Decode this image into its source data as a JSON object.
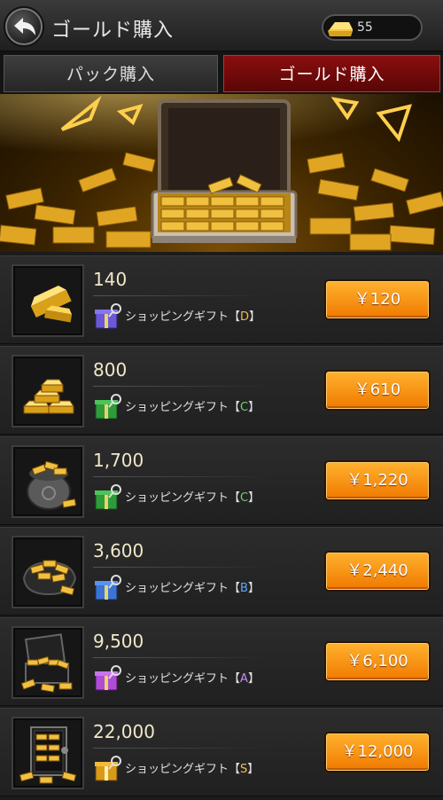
{
  "header": {
    "title": "ゴールド購入",
    "gold_balance": "55",
    "back_icon": "back-arrow-icon",
    "gold_icon": "gold-ingot-icon"
  },
  "tabs": [
    {
      "label": "パック購入",
      "active": false
    },
    {
      "label": "ゴールド購入",
      "active": true
    }
  ],
  "colors": {
    "accent": "#f59a10",
    "active_tab": "#7a0b0b",
    "rank_D": "#f5b942",
    "rank_C": "#6fd06f",
    "rank_B": "#5aa6ff",
    "rank_A": "#c88cff",
    "rank_S": "#f5c842"
  },
  "products": [
    {
      "amount": "140",
      "gift_label": "ショッピングギフト",
      "gift_rank": "D",
      "gift_open": "【",
      "gift_close": "】",
      "price": "￥120",
      "gift_color": "#7a5cff",
      "icon": "gold-bar-icon"
    },
    {
      "amount": "800",
      "gift_label": "ショッピングギフト",
      "gift_rank": "C",
      "gift_open": "【",
      "gift_close": "】",
      "price": "￥610",
      "gift_color": "#2f9c3a",
      "icon": "gold-stack-icon"
    },
    {
      "amount": "1,700",
      "gift_label": "ショッピングギフト",
      "gift_rank": "C",
      "gift_open": "【",
      "gift_close": "】",
      "price": "￥1,220",
      "gift_color": "#2f9c3a",
      "icon": "gold-sack-icon"
    },
    {
      "amount": "3,600",
      "gift_label": "ショッピングギフト",
      "gift_rank": "B",
      "gift_open": "【",
      "gift_close": "】",
      "price": "￥2,440",
      "gift_color": "#3c74d6",
      "icon": "gold-bag-icon"
    },
    {
      "amount": "9,500",
      "gift_label": "ショッピングギフト",
      "gift_rank": "A",
      "gift_open": "【",
      "gift_close": "】",
      "price": "￥6,100",
      "gift_color": "#b04dd6",
      "icon": "gold-chest-icon"
    },
    {
      "amount": "22,000",
      "gift_label": "ショッピングギフト",
      "gift_rank": "S",
      "gift_open": "【",
      "gift_close": "】",
      "price": "￥12,000",
      "gift_color": "#d99a1a",
      "icon": "gold-safe-icon"
    }
  ]
}
